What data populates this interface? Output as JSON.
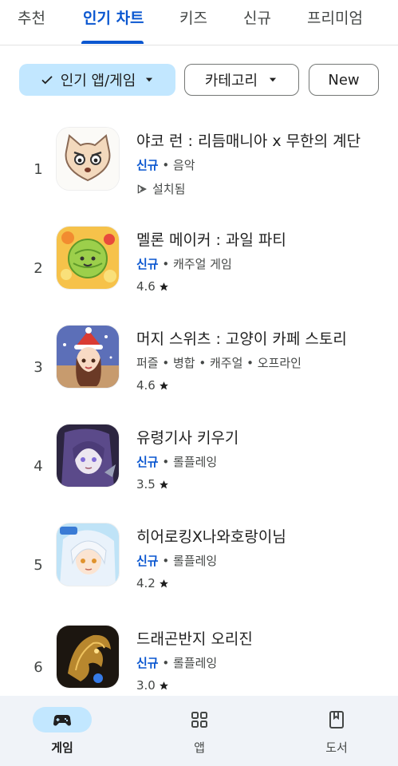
{
  "tabs": [
    {
      "label": "추천"
    },
    {
      "label": "인기 차트",
      "active": true
    },
    {
      "label": "키즈"
    },
    {
      "label": "신규"
    },
    {
      "label": "프리미엄"
    }
  ],
  "filters": {
    "category_type": "인기 앱/게임",
    "category": "카테고리",
    "new": "New"
  },
  "apps": [
    {
      "rank": "1",
      "title": "야코 런 : 리듬매니아 x 무한의 계단",
      "new_badge": "신규",
      "tags": "음악",
      "sub": "설치됨",
      "sub_icon": "installed-icon"
    },
    {
      "rank": "2",
      "title": "멜론 메이커 : 과일 파티",
      "new_badge": "신규",
      "tags": "캐주얼 게임",
      "sub": "4.6",
      "sub_icon": "star-icon"
    },
    {
      "rank": "3",
      "title": "머지 스위츠 : 고양이 카페 스토리",
      "new_badge": "",
      "tags": "퍼즐 • 병합 • 캐주얼 • 오프라인",
      "sub": "4.6",
      "sub_icon": "star-icon"
    },
    {
      "rank": "4",
      "title": "유령기사 키우기",
      "new_badge": "신규",
      "tags": "롤플레잉",
      "sub": "3.5",
      "sub_icon": "star-icon"
    },
    {
      "rank": "5",
      "title": "히어로킹X나와호랑이님",
      "new_badge": "신규",
      "tags": "롤플레잉",
      "sub": "4.2",
      "sub_icon": "star-icon"
    },
    {
      "rank": "6",
      "title": "드래곤반지 오리진",
      "new_badge": "신규",
      "tags": "롤플레잉",
      "sub": "3.0",
      "sub_icon": "star-icon"
    }
  ],
  "bottom_nav": {
    "games": "게임",
    "apps": "앱",
    "books": "도서"
  },
  "colors": {
    "accent": "#0b57d0",
    "chip_selected": "#c2e7ff",
    "nav_bg": "#f0f3f8"
  }
}
